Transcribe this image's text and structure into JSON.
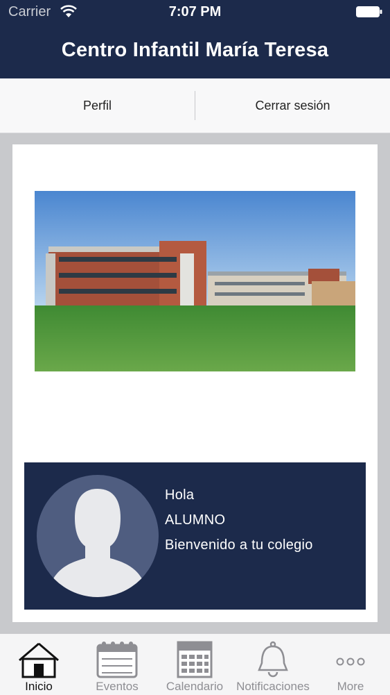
{
  "status_bar": {
    "carrier": "Carrier",
    "time": "7:07 PM"
  },
  "header": {
    "title": "Centro Infantil María Teresa",
    "background_color": "#1c2a4b"
  },
  "actions": {
    "profile_label": "Perfil",
    "logout_label": "Cerrar sesión"
  },
  "school_photo": {
    "icon": "school-building-photo"
  },
  "profile": {
    "greeting": "Hola",
    "name": "ALUMNO",
    "welcome": "Bienvenido a tu colegio",
    "avatar_icon": "person-silhouette-icon",
    "background_color": "#1c2a4b"
  },
  "tabs": [
    {
      "label": "Inicio",
      "icon": "home-icon",
      "active": true
    },
    {
      "label": "Eventos",
      "icon": "calendar-icon",
      "active": false
    },
    {
      "label": "Calendario",
      "icon": "schedule-icon",
      "active": false
    },
    {
      "label": "Notificaciones",
      "icon": "bell-icon",
      "active": false
    },
    {
      "label": "More",
      "icon": "more-icon",
      "active": false
    }
  ]
}
